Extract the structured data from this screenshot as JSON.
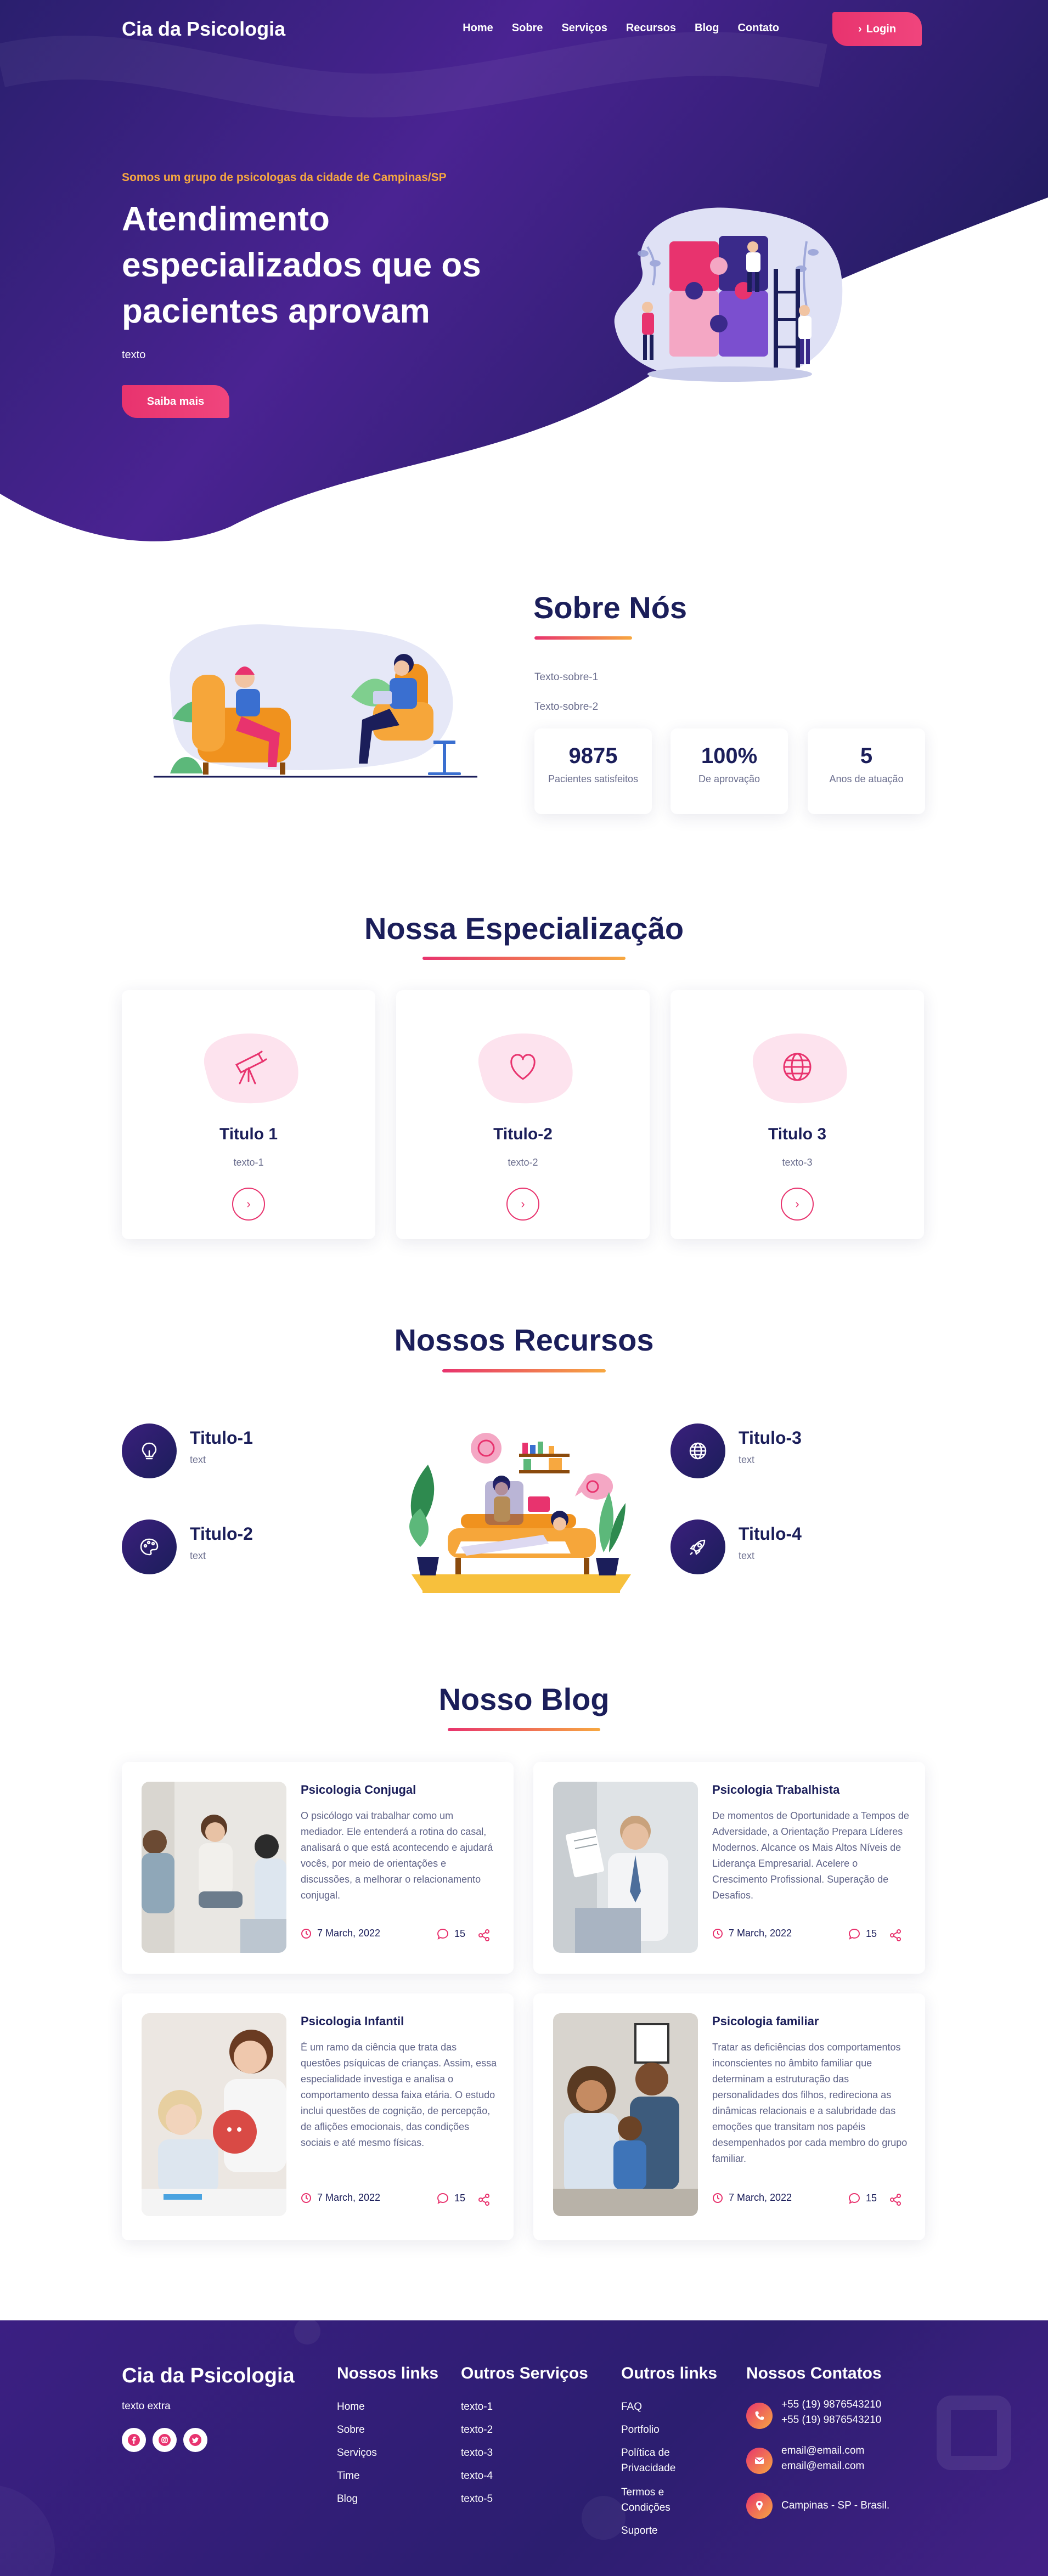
{
  "brand": "Cia da Psicologia",
  "nav": {
    "items": [
      "Home",
      "Sobre",
      "Serviços",
      "Recursos",
      "Blog",
      "Contato"
    ],
    "login": "Login"
  },
  "hero": {
    "subtitle": "Somos um grupo de psicologas da cidade de Campinas/SP",
    "title": "Atendimento especializados que os pacientes aprovam",
    "text": "texto",
    "button": "Saiba mais"
  },
  "about": {
    "title": "Sobre Nós",
    "paragraphs": [
      "Texto-sobre-1",
      "Texto-sobre-2"
    ],
    "stats": [
      {
        "value": "9875",
        "label": "Pacientes satisfeitos"
      },
      {
        "value": "100%",
        "label": "De aprovação"
      },
      {
        "value": "5",
        "label": "Anos de atuação"
      }
    ]
  },
  "specialization": {
    "title": "Nossa Especialização",
    "cards": [
      {
        "title": "Titulo 1",
        "text": "texto-1",
        "icon": "telescope-icon"
      },
      {
        "title": "Titulo-2",
        "text": "texto-2",
        "icon": "heart-icon"
      },
      {
        "title": "Titulo 3",
        "text": "texto-3",
        "icon": "globe-icon"
      }
    ]
  },
  "resources": {
    "title": "Nossos Recursos",
    "items": [
      {
        "title": "Titulo-1",
        "text": "text",
        "icon": "lightbulb-icon"
      },
      {
        "title": "Titulo-2",
        "text": "text",
        "icon": "palette-icon"
      },
      {
        "title": "Titulo-3",
        "text": "text",
        "icon": "globe-icon"
      },
      {
        "title": "Titulo-4",
        "text": "text",
        "icon": "rocket-icon"
      }
    ]
  },
  "blog": {
    "title": "Nosso Blog",
    "posts": [
      {
        "title": "Psicologia Conjugal",
        "text": "O psicólogo vai trabalhar como um mediador. Ele entenderá a rotina do casal, analisará o que está acontecendo e ajudará vocês, por meio de orientações e discussões, a melhorar o relacionamento conjugal.",
        "date": "7 March, 2022",
        "comments": "15"
      },
      {
        "title": "Psicologia Trabalhista",
        "text": "De momentos de Oportunidade a Tempos de Adversidade, a Orientação Prepara Líderes Modernos. Alcance os Mais Altos Níveis de Liderança Empresarial. Acelere o Crescimento Profissional. Superação de Desafios.",
        "date": "7 March, 2022",
        "comments": "15"
      },
      {
        "title": "Psicologia Infantil",
        "text": "É um ramo da ciência que trata das questões psíquicas de crianças. Assim, essa especialidade investiga e analisa o comportamento dessa faixa etária. O estudo inclui questões de cognição, de percepção, de aflições emocionais, das condições sociais e até mesmo físicas.",
        "date": "7 March, 2022",
        "comments": "15"
      },
      {
        "title": "Psicologia familiar",
        "text": "Tratar as deficiências dos comportamentos inconscientes no âmbito familiar que determinam a estruturação das personalidades dos filhos, redireciona as dinâmicas relacionais e a salubridade das emoções que transitam nos papéis desempenhados por cada membro do grupo familiar.",
        "date": "7 March, 2022",
        "comments": "15"
      }
    ]
  },
  "footer": {
    "brand": "Cia da Psicologia",
    "extra": "texto extra",
    "social": [
      "facebook-icon",
      "instagram-icon",
      "twitter-icon"
    ],
    "links_title": "Nossos links",
    "links": [
      "Home",
      "Sobre",
      "Serviços",
      "Time",
      "Blog"
    ],
    "services_title": "Outros Serviços",
    "services": [
      "texto-1",
      "texto-2",
      "texto-3",
      "texto-4",
      "texto-5"
    ],
    "other_title": "Outros links",
    "other": [
      "FAQ",
      "Portfolio",
      "Política de Privacidade",
      "Termos e Condições",
      "Suporte"
    ],
    "contacts_title": "Nossos Contatos",
    "phones": [
      "+55 (19) 9876543210",
      "+55 (19) 9876543210"
    ],
    "emails": [
      "email@email.com",
      "email@email.com"
    ],
    "address": "Campinas - SP - Brasil."
  },
  "colors": {
    "navy": "#1b1e5a",
    "purple": "#4a2392",
    "pink": "#e8336e",
    "orange": "#f7a840"
  }
}
